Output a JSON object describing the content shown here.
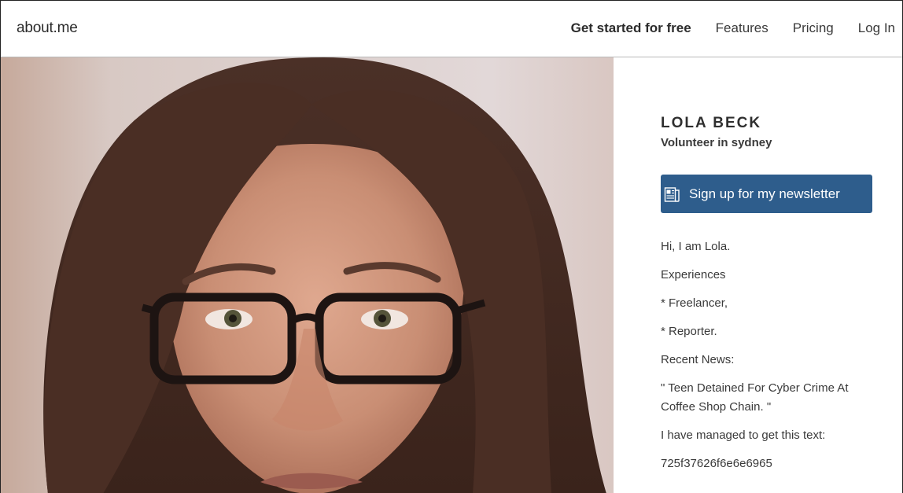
{
  "header": {
    "logo": "about.me",
    "nav": [
      {
        "label": "Get started for free"
      },
      {
        "label": "Features"
      },
      {
        "label": "Pricing"
      },
      {
        "label": "Log In"
      }
    ]
  },
  "profile": {
    "name": "LOLA BECK",
    "headline": "Volunteer in sydney",
    "cta": {
      "label": "Sign up for my newsletter",
      "icon": "newsletter-icon"
    },
    "bio": [
      "Hi, I am Lola.",
      "Experiences",
      "* Freelancer,",
      "* Reporter.",
      "Recent News:",
      "\" Teen Detained For Cyber Crime At Coffee Shop Chain. \"",
      "I have managed to get this text:",
      "725f37626f6e6e6965"
    ]
  },
  "colors": {
    "cta_background": "#2e5d8c",
    "header_border": "#b9b9b9"
  }
}
